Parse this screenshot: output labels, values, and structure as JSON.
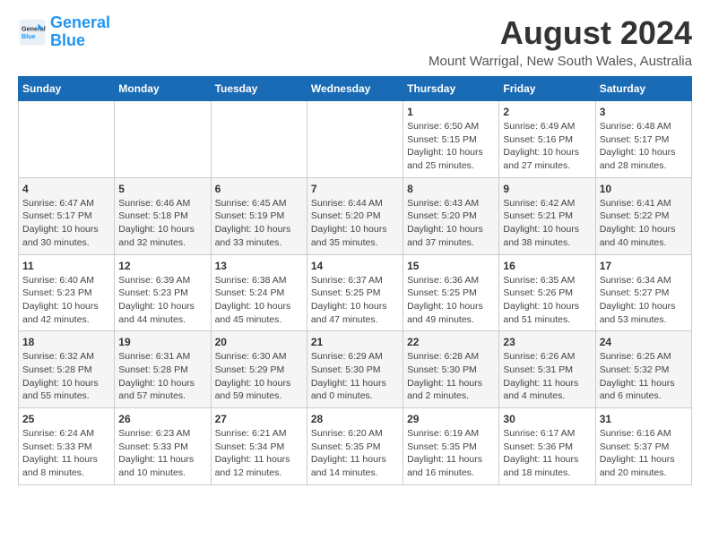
{
  "logo": {
    "line1": "General",
    "line2": "Blue"
  },
  "title": "August 2024",
  "location": "Mount Warrigal, New South Wales, Australia",
  "days_of_week": [
    "Sunday",
    "Monday",
    "Tuesday",
    "Wednesday",
    "Thursday",
    "Friday",
    "Saturday"
  ],
  "weeks": [
    [
      {
        "day": "",
        "info": ""
      },
      {
        "day": "",
        "info": ""
      },
      {
        "day": "",
        "info": ""
      },
      {
        "day": "",
        "info": ""
      },
      {
        "day": "1",
        "info": "Sunrise: 6:50 AM\nSunset: 5:15 PM\nDaylight: 10 hours\nand 25 minutes."
      },
      {
        "day": "2",
        "info": "Sunrise: 6:49 AM\nSunset: 5:16 PM\nDaylight: 10 hours\nand 27 minutes."
      },
      {
        "day": "3",
        "info": "Sunrise: 6:48 AM\nSunset: 5:17 PM\nDaylight: 10 hours\nand 28 minutes."
      }
    ],
    [
      {
        "day": "4",
        "info": "Sunrise: 6:47 AM\nSunset: 5:17 PM\nDaylight: 10 hours\nand 30 minutes."
      },
      {
        "day": "5",
        "info": "Sunrise: 6:46 AM\nSunset: 5:18 PM\nDaylight: 10 hours\nand 32 minutes."
      },
      {
        "day": "6",
        "info": "Sunrise: 6:45 AM\nSunset: 5:19 PM\nDaylight: 10 hours\nand 33 minutes."
      },
      {
        "day": "7",
        "info": "Sunrise: 6:44 AM\nSunset: 5:20 PM\nDaylight: 10 hours\nand 35 minutes."
      },
      {
        "day": "8",
        "info": "Sunrise: 6:43 AM\nSunset: 5:20 PM\nDaylight: 10 hours\nand 37 minutes."
      },
      {
        "day": "9",
        "info": "Sunrise: 6:42 AM\nSunset: 5:21 PM\nDaylight: 10 hours\nand 38 minutes."
      },
      {
        "day": "10",
        "info": "Sunrise: 6:41 AM\nSunset: 5:22 PM\nDaylight: 10 hours\nand 40 minutes."
      }
    ],
    [
      {
        "day": "11",
        "info": "Sunrise: 6:40 AM\nSunset: 5:23 PM\nDaylight: 10 hours\nand 42 minutes."
      },
      {
        "day": "12",
        "info": "Sunrise: 6:39 AM\nSunset: 5:23 PM\nDaylight: 10 hours\nand 44 minutes."
      },
      {
        "day": "13",
        "info": "Sunrise: 6:38 AM\nSunset: 5:24 PM\nDaylight: 10 hours\nand 45 minutes."
      },
      {
        "day": "14",
        "info": "Sunrise: 6:37 AM\nSunset: 5:25 PM\nDaylight: 10 hours\nand 47 minutes."
      },
      {
        "day": "15",
        "info": "Sunrise: 6:36 AM\nSunset: 5:25 PM\nDaylight: 10 hours\nand 49 minutes."
      },
      {
        "day": "16",
        "info": "Sunrise: 6:35 AM\nSunset: 5:26 PM\nDaylight: 10 hours\nand 51 minutes."
      },
      {
        "day": "17",
        "info": "Sunrise: 6:34 AM\nSunset: 5:27 PM\nDaylight: 10 hours\nand 53 minutes."
      }
    ],
    [
      {
        "day": "18",
        "info": "Sunrise: 6:32 AM\nSunset: 5:28 PM\nDaylight: 10 hours\nand 55 minutes."
      },
      {
        "day": "19",
        "info": "Sunrise: 6:31 AM\nSunset: 5:28 PM\nDaylight: 10 hours\nand 57 minutes."
      },
      {
        "day": "20",
        "info": "Sunrise: 6:30 AM\nSunset: 5:29 PM\nDaylight: 10 hours\nand 59 minutes."
      },
      {
        "day": "21",
        "info": "Sunrise: 6:29 AM\nSunset: 5:30 PM\nDaylight: 11 hours\nand 0 minutes."
      },
      {
        "day": "22",
        "info": "Sunrise: 6:28 AM\nSunset: 5:30 PM\nDaylight: 11 hours\nand 2 minutes."
      },
      {
        "day": "23",
        "info": "Sunrise: 6:26 AM\nSunset: 5:31 PM\nDaylight: 11 hours\nand 4 minutes."
      },
      {
        "day": "24",
        "info": "Sunrise: 6:25 AM\nSunset: 5:32 PM\nDaylight: 11 hours\nand 6 minutes."
      }
    ],
    [
      {
        "day": "25",
        "info": "Sunrise: 6:24 AM\nSunset: 5:33 PM\nDaylight: 11 hours\nand 8 minutes."
      },
      {
        "day": "26",
        "info": "Sunrise: 6:23 AM\nSunset: 5:33 PM\nDaylight: 11 hours\nand 10 minutes."
      },
      {
        "day": "27",
        "info": "Sunrise: 6:21 AM\nSunset: 5:34 PM\nDaylight: 11 hours\nand 12 minutes."
      },
      {
        "day": "28",
        "info": "Sunrise: 6:20 AM\nSunset: 5:35 PM\nDaylight: 11 hours\nand 14 minutes."
      },
      {
        "day": "29",
        "info": "Sunrise: 6:19 AM\nSunset: 5:35 PM\nDaylight: 11 hours\nand 16 minutes."
      },
      {
        "day": "30",
        "info": "Sunrise: 6:17 AM\nSunset: 5:36 PM\nDaylight: 11 hours\nand 18 minutes."
      },
      {
        "day": "31",
        "info": "Sunrise: 6:16 AM\nSunset: 5:37 PM\nDaylight: 11 hours\nand 20 minutes."
      }
    ]
  ]
}
